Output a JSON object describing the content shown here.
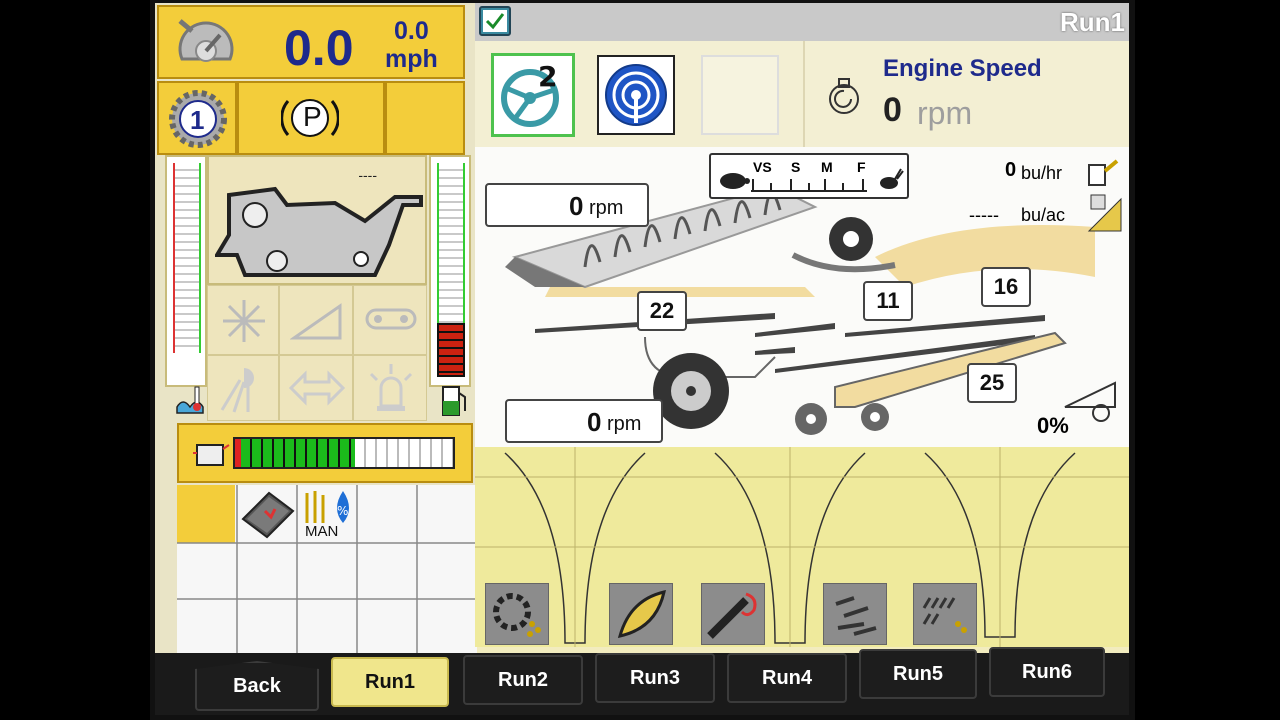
{
  "speed": {
    "value": "0.0",
    "unit_top": "0.0",
    "unit_bottom": "mph"
  },
  "gear": {
    "number": "1",
    "park_label": "P"
  },
  "machine": {
    "status_dashes": "----"
  },
  "top": {
    "run_title": "Run1"
  },
  "engine": {
    "label": "Engine Speed",
    "value": "0",
    "unit": "rpm"
  },
  "diagram": {
    "rotor_rpm": "0",
    "rpm_unit": "rpm",
    "feeder_rpm": "0",
    "speed_scale": [
      "VS",
      "S",
      "M",
      "F"
    ],
    "yield_rate": "0",
    "yield_rate_unit": "bu/hr",
    "yield_area": "-----",
    "yield_area_unit": "bu/ac",
    "box_22": "22",
    "box_11": "11",
    "box_16": "16",
    "box_25": "25",
    "loss_percent": "0%"
  },
  "grid": {
    "man_label": "MAN"
  },
  "tabs": [
    "Back",
    "Run1",
    "Run2",
    "Run3",
    "Run4",
    "Run5",
    "Run6"
  ],
  "colors": {
    "accent_yellow": "#f3cd3a",
    "text_blue": "#1e2a8c",
    "fuel_green": "#1bbb1b"
  },
  "fuel_level_fraction": 0.45
}
